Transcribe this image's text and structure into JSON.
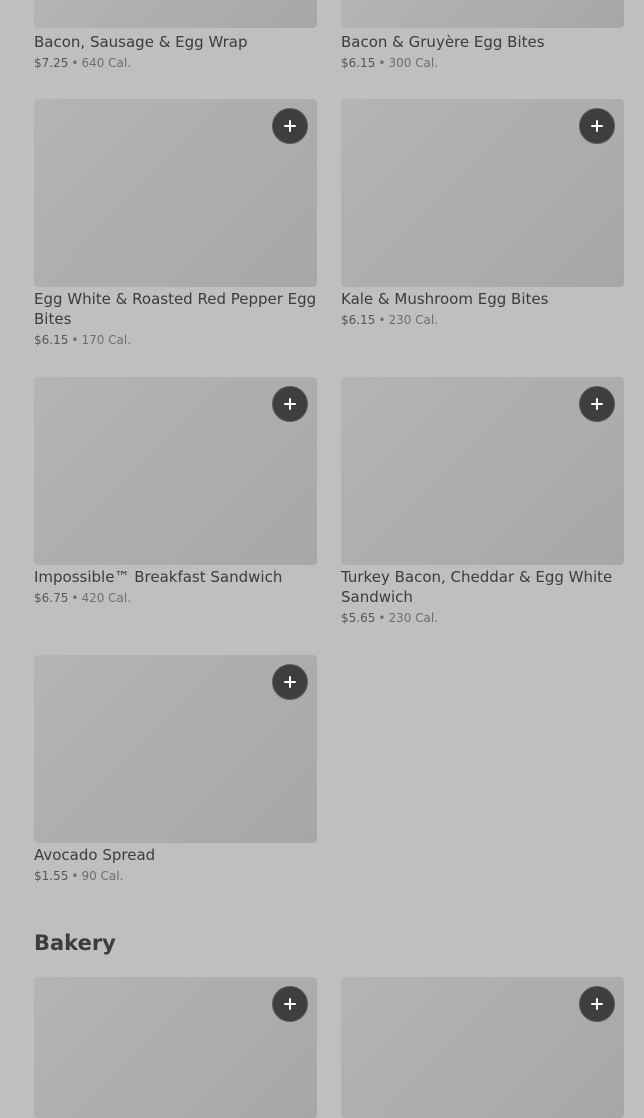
{
  "items_top": [
    {
      "name": "Bacon, Sausage & Egg Wrap",
      "price": "$7.25",
      "calories": "640 Cal."
    },
    {
      "name": "Bacon & Gruyère Egg Bites",
      "price": "$6.15",
      "calories": "300 Cal."
    }
  ],
  "items": [
    {
      "name": "Egg White & Roasted Red Pepper Egg Bites",
      "price": "$6.15",
      "calories": "170 Cal."
    },
    {
      "name": "Kale & Mushroom Egg Bites",
      "price": "$6.15",
      "calories": "230 Cal."
    },
    {
      "name": "Impossible™ Breakfast Sandwich",
      "price": "$6.75",
      "calories": "420 Cal."
    },
    {
      "name": "Turkey Bacon, Cheddar & Egg White Sandwich",
      "price": "$5.65",
      "calories": "230 Cal."
    },
    {
      "name": "Avocado Spread",
      "price": "$1.55",
      "calories": "90 Cal."
    }
  ],
  "bakery": {
    "title": "Bakery"
  },
  "separator": "•",
  "icons": {
    "add": "plus-icon"
  }
}
